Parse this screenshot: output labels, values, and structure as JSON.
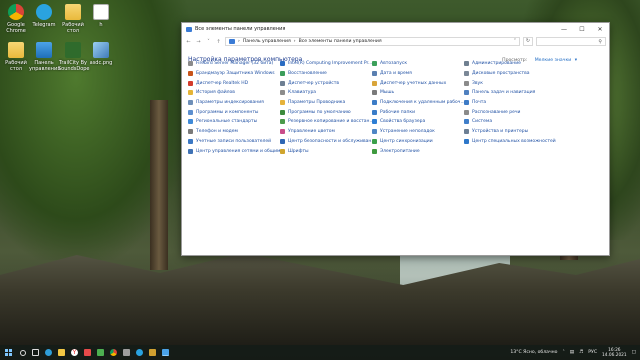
{
  "desktop": {
    "icons": [
      {
        "label": "Google Chrome",
        "icon": "chrome-icon"
      },
      {
        "label": "Telegram",
        "icon": "telegram-icon"
      },
      {
        "label": "Рабочий стол",
        "icon": "folder-icon"
      },
      {
        "label": "h",
        "icon": "file-icon"
      },
      {
        "label": "Рабочий стол",
        "icon": "folder-icon"
      },
      {
        "label": "Панель управления",
        "icon": "control-panel-icon"
      },
      {
        "label": "TrailCity By SoundsDope",
        "icon": "app-icon"
      },
      {
        "label": "asdc.png",
        "icon": "image-icon"
      }
    ]
  },
  "window": {
    "title": "Все элементы панели управления",
    "address": {
      "crumb1": "Панель управления",
      "crumb2": "Все элементы панели управления"
    },
    "heading": "Настройка параметров компьютера",
    "view_by_label": "Просмотр:",
    "view_by_value": "Мелкие значки",
    "columns": [
      [
        {
          "label": "Firebird Server Manager (32 бита)",
          "icon": "firebird-icon",
          "color": "#8b8b8b"
        },
        {
          "label": "Брандмауэр Защитника Windows",
          "icon": "firewall-icon",
          "color": "#c8541a"
        },
        {
          "label": "Диспетчер Realtek HD",
          "icon": "realtek-icon",
          "color": "#d33c2c"
        },
        {
          "label": "История файлов",
          "icon": "file-history-icon",
          "color": "#e5b436"
        },
        {
          "label": "Параметры индексирования",
          "icon": "indexing-icon",
          "color": "#6e8fb8"
        },
        {
          "label": "Программы и компоненты",
          "icon": "programs-icon",
          "color": "#5c8fcf"
        },
        {
          "label": "Региональные стандарты",
          "icon": "region-icon",
          "color": "#3f8ad8"
        },
        {
          "label": "Телефон и модем",
          "icon": "phone-icon",
          "color": "#7a7a7a"
        },
        {
          "label": "Учетные записи пользователей",
          "icon": "users-icon",
          "color": "#3b78c4"
        },
        {
          "label": "Центр управления сетями и общим...",
          "icon": "network-icon",
          "color": "#3f72b5"
        }
      ],
      [
        {
          "label": "Intel(R) Computing Improvement Pr...",
          "icon": "intel-icon",
          "color": "#2a6cc2"
        },
        {
          "label": "Восстановление",
          "icon": "recovery-icon",
          "color": "#3b9d5b"
        },
        {
          "label": "Диспетчер устройств",
          "icon": "device-manager-icon",
          "color": "#6d7f93"
        },
        {
          "label": "Клавиатура",
          "icon": "keyboard-icon",
          "color": "#8c8c8c"
        },
        {
          "label": "Параметры Проводника",
          "icon": "explorer-options-icon",
          "color": "#e6b23a"
        },
        {
          "label": "Программы по умолчанию",
          "icon": "default-programs-icon",
          "color": "#3c8b3c"
        },
        {
          "label": "Резервное копирование и восстан...",
          "icon": "backup-icon",
          "color": "#4b9a4b"
        },
        {
          "label": "Управление цветом",
          "icon": "color-management-icon",
          "color": "#c94c8a"
        },
        {
          "label": "Центр безопасности и обслуживан...",
          "icon": "security-center-icon",
          "color": "#2f66b3"
        },
        {
          "label": "Шрифты",
          "icon": "fonts-icon",
          "color": "#d0a52e"
        }
      ],
      [
        {
          "label": "Автозапуск",
          "icon": "autoplay-icon",
          "color": "#3ca05a"
        },
        {
          "label": "Дата и время",
          "icon": "datetime-icon",
          "color": "#5a7fb0"
        },
        {
          "label": "Диспетчер учетных данных",
          "icon": "credentials-icon",
          "color": "#d9a53a"
        },
        {
          "label": "Мышь",
          "icon": "mouse-icon",
          "color": "#7a7a7a"
        },
        {
          "label": "Подключения к удаленным рабоч...",
          "icon": "remote-icon",
          "color": "#3c7cc6"
        },
        {
          "label": "Рабочие папки",
          "icon": "work-folders-icon",
          "color": "#3a7dc8"
        },
        {
          "label": "Свойства браузера",
          "icon": "browser-icon",
          "color": "#2d7ed4"
        },
        {
          "label": "Устранение неполадок",
          "icon": "troubleshoot-icon",
          "color": "#4e86c5"
        },
        {
          "label": "Центр синхронизации",
          "icon": "sync-icon",
          "color": "#3aa04a"
        },
        {
          "label": "Электропитание",
          "icon": "power-icon",
          "color": "#3e9a3e"
        }
      ],
      [
        {
          "label": "Администрирование",
          "icon": "admin-icon",
          "color": "#6f7f90"
        },
        {
          "label": "Дисковые пространства",
          "icon": "storage-icon",
          "color": "#7a8796"
        },
        {
          "label": "Звук",
          "icon": "sound-icon",
          "color": "#8b8b8b"
        },
        {
          "label": "Панель задач и навигация",
          "icon": "taskbar-icon",
          "color": "#4f80bf"
        },
        {
          "label": "Почта",
          "icon": "mail-icon",
          "color": "#3d7bc6"
        },
        {
          "label": "Распознавание речи",
          "icon": "speech-icon",
          "color": "#8a8a8a"
        },
        {
          "label": "Система",
          "icon": "system-icon",
          "color": "#3f7ec9"
        },
        {
          "label": "Устройства и принтеры",
          "icon": "printer-icon",
          "color": "#6c7f94"
        },
        {
          "label": "Центр специальных возможностей",
          "icon": "accessibility-icon",
          "color": "#2d77c9"
        }
      ]
    ]
  },
  "taskbar": {
    "weather": "13°C  Ясно, облачно",
    "lang": "РУС",
    "time": "16:26",
    "date": "14.06.2021"
  }
}
